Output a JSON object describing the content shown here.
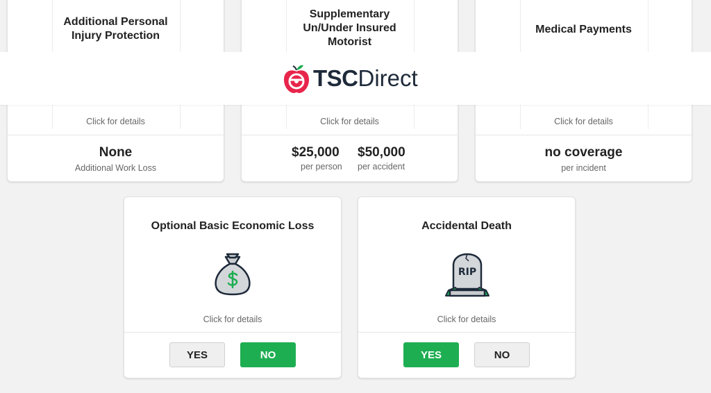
{
  "colors": {
    "accent_green": "#1eae52",
    "brand_red": "#e8254b",
    "brand_dark": "#1e2a3a"
  },
  "header": {
    "logo_bold": "TSC",
    "logo_light": "Direct"
  },
  "cards": {
    "pip": {
      "title": "Additional Personal Injury Protection",
      "details": "Click for details",
      "value": "None",
      "value_sub": "Additional Work Loss"
    },
    "supplementary": {
      "title": "Supplementary Un/Under Insured Motorist",
      "details": "Click for details",
      "per_person_value": "$25,000",
      "per_person_label": "per person",
      "per_accident_value": "$50,000",
      "per_accident_label": "per accident"
    },
    "medical": {
      "title": "Medical Payments",
      "details": "Click for details",
      "value": "no coverage",
      "value_sub": "per incident"
    },
    "basic_loss": {
      "title": "Optional Basic Economic Loss",
      "icon": "money-bag-icon",
      "details": "Click for details",
      "yes_label": "YES",
      "no_label": "NO",
      "selected": "NO"
    },
    "accidental_death": {
      "title": "Accidental Death",
      "icon": "tombstone-icon",
      "icon_text": "RIP",
      "details": "Click for details",
      "yes_label": "YES",
      "no_label": "NO",
      "selected": "YES"
    }
  }
}
